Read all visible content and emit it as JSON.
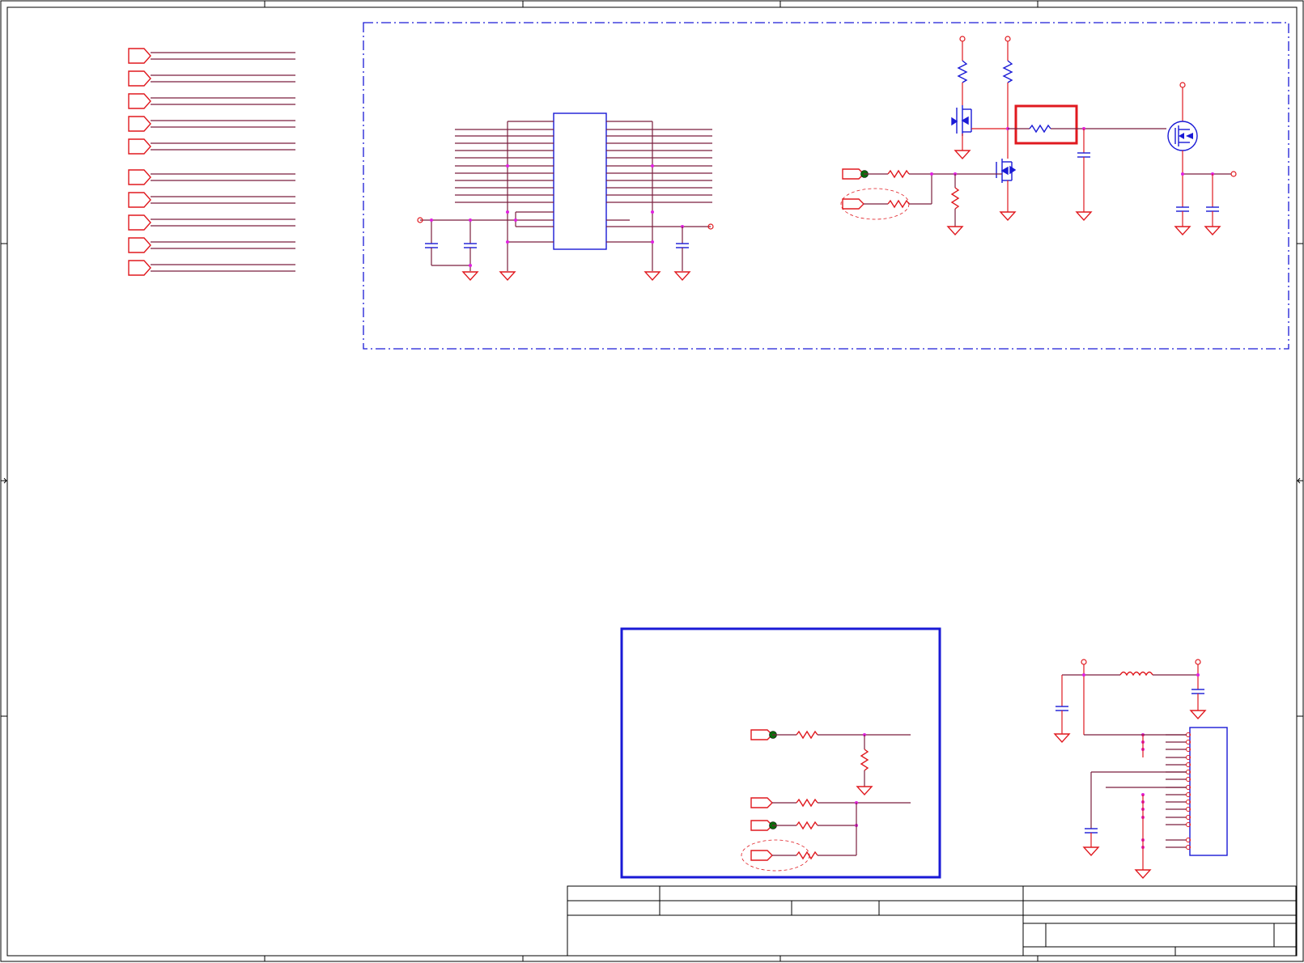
{
  "sheet": {
    "colors": {
      "wire": "#7a1f3d",
      "port": "#e0191f",
      "component": "#1a1ad6",
      "junction": "#e020e0",
      "net_tie": "#0a6a0a",
      "frame": "#000000"
    },
    "visible_text": []
  }
}
